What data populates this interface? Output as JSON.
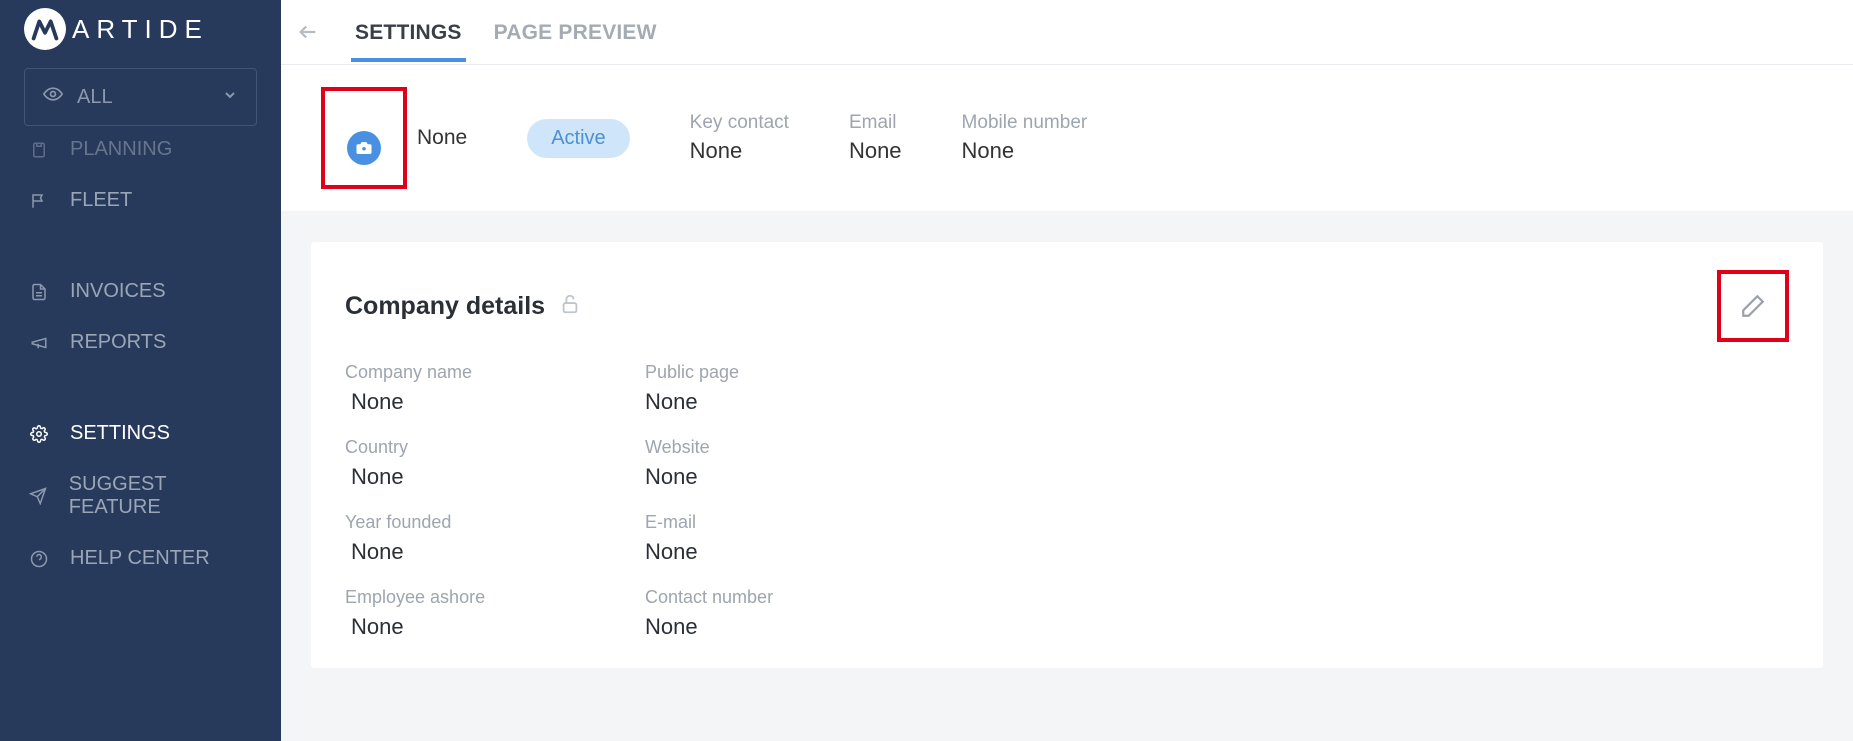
{
  "logo_text": "ARTIDE",
  "view_selector": {
    "label": "ALL"
  },
  "sidebar": {
    "items": [
      {
        "id": "planning",
        "label": "PLANNING",
        "icon": "clipboard",
        "active": false
      },
      {
        "id": "fleet",
        "label": "FLEET",
        "icon": "flag",
        "active": false
      },
      {
        "id": "invoices",
        "label": "INVOICES",
        "icon": "file",
        "active": false
      },
      {
        "id": "reports",
        "label": "REPORTS",
        "icon": "megaphone",
        "active": false
      },
      {
        "id": "settings",
        "label": "SETTINGS",
        "icon": "gear",
        "active": true
      },
      {
        "id": "suggest",
        "label": "SUGGEST FEATURE",
        "icon": "send",
        "active": false
      },
      {
        "id": "help",
        "label": "HELP CENTER",
        "icon": "help",
        "active": false
      }
    ]
  },
  "tabs": {
    "settings": "SETTINGS",
    "preview": "PAGE PREVIEW"
  },
  "summary": {
    "name": "None",
    "status": "Active",
    "key_contact": {
      "label": "Key contact",
      "value": "None"
    },
    "email": {
      "label": "Email",
      "value": "None"
    },
    "mobile": {
      "label": "Mobile number",
      "value": "None"
    }
  },
  "details": {
    "title": "Company details",
    "fields": {
      "company_name": {
        "label": "Company name",
        "value": "None"
      },
      "public_page": {
        "label": "Public page",
        "value": "None"
      },
      "country": {
        "label": "Country",
        "value": "None"
      },
      "website": {
        "label": "Website",
        "value": "None"
      },
      "year_founded": {
        "label": "Year founded",
        "value": "None"
      },
      "email": {
        "label": "E-mail",
        "value": "None"
      },
      "employee_ashore": {
        "label": "Employee ashore",
        "value": "None"
      },
      "contact_number": {
        "label": "Contact number",
        "value": "None"
      }
    }
  }
}
